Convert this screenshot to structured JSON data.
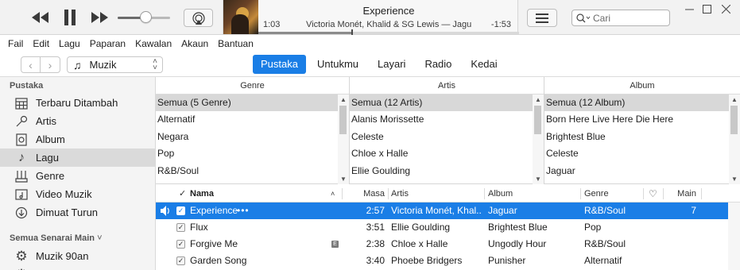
{
  "player": {
    "now_playing": {
      "title": "Experience",
      "subtitle": "Victoria Monét, Khalid & SG Lewis — Jaguar",
      "elapsed": "1:03",
      "remaining": "-1:53",
      "progress": 0.36
    },
    "volume": 0.55,
    "search": {
      "placeholder": "Cari",
      "value": ""
    },
    "icons": {
      "previous": "rewind-icon",
      "pause": "pause-icon",
      "next": "fast-forward-icon",
      "airplay": "airplay-icon",
      "up_next": "list-icon",
      "search": "search-icon"
    }
  },
  "menubar": {
    "items": [
      "Fail",
      "Edit",
      "Lagu",
      "Paparan",
      "Kawalan",
      "Akaun",
      "Bantuan"
    ]
  },
  "navbar": {
    "media_selector": "Muzik",
    "tabs": [
      {
        "label": "Pustaka",
        "active": true
      },
      {
        "label": "Untukmu",
        "active": false
      },
      {
        "label": "Layari",
        "active": false
      },
      {
        "label": "Radio",
        "active": false
      },
      {
        "label": "Kedai",
        "active": false
      }
    ]
  },
  "sidebar": {
    "library_header": "Pustaka",
    "items": [
      {
        "label": "Terbaru Ditambah",
        "icon": "calendar-grid-icon"
      },
      {
        "label": "Artis",
        "icon": "microphone-icon"
      },
      {
        "label": "Album",
        "icon": "album-icon"
      },
      {
        "label": "Lagu",
        "icon": "music-note-icon",
        "selected": true
      },
      {
        "label": "Genre",
        "icon": "genre-icon"
      },
      {
        "label": "Video Muzik",
        "icon": "music-video-icon"
      },
      {
        "label": "Dimuat Turun",
        "icon": "download-icon"
      }
    ],
    "playlists_header": "Semua Senarai Main",
    "playlists": [
      {
        "label": "Muzik 90an",
        "icon": "gear-icon"
      }
    ]
  },
  "browser": {
    "columns": [
      {
        "header": "Genre",
        "items": [
          "Semua (5 Genre)",
          "Alternatif",
          "Negara",
          "Pop",
          "R&B/Soul"
        ]
      },
      {
        "header": "Artis",
        "items": [
          "Semua (12 Artis)",
          "Alanis Morissette",
          "Celeste",
          "Chloe x Halle",
          "Ellie Goulding"
        ]
      },
      {
        "header": "Album",
        "items": [
          "Semua (12 Album)",
          "Born Here Live Here Die Here",
          "Brightest Blue",
          "Celeste",
          "Jaguar"
        ]
      }
    ]
  },
  "songs": {
    "headers": {
      "check": "✓",
      "name": "Nama",
      "time": "Masa",
      "artist": "Artis",
      "album": "Album",
      "genre": "Genre",
      "love": "♡",
      "plays": "Main"
    },
    "rows": [
      {
        "name": "Experience",
        "more": "•••",
        "time": "2:57",
        "artist": "Victoria Monét, Khal...",
        "album": "Jaguar",
        "genre": "R&B/Soul",
        "plays": "7",
        "playing": true,
        "explicit": false
      },
      {
        "name": "Flux",
        "more": "",
        "time": "3:51",
        "artist": "Ellie Goulding",
        "album": "Brightest Blue",
        "genre": "Pop",
        "plays": "",
        "playing": false,
        "explicit": false
      },
      {
        "name": "Forgive Me",
        "more": "",
        "time": "2:38",
        "artist": "Chloe x Halle",
        "album": "Ungodly Hour",
        "genre": "R&B/Soul",
        "plays": "",
        "playing": false,
        "explicit": true
      },
      {
        "name": "Garden Song",
        "more": "",
        "time": "3:40",
        "artist": "Phoebe Bridgers",
        "album": "Punisher",
        "genre": "Alternatif",
        "plays": "",
        "playing": false,
        "explicit": false
      }
    ],
    "explicit_badge": "E"
  },
  "colors": {
    "accent": "#1a7ee6",
    "sidebar_bg": "#f4f4f4",
    "selection_gray": "#d8d8d8"
  }
}
